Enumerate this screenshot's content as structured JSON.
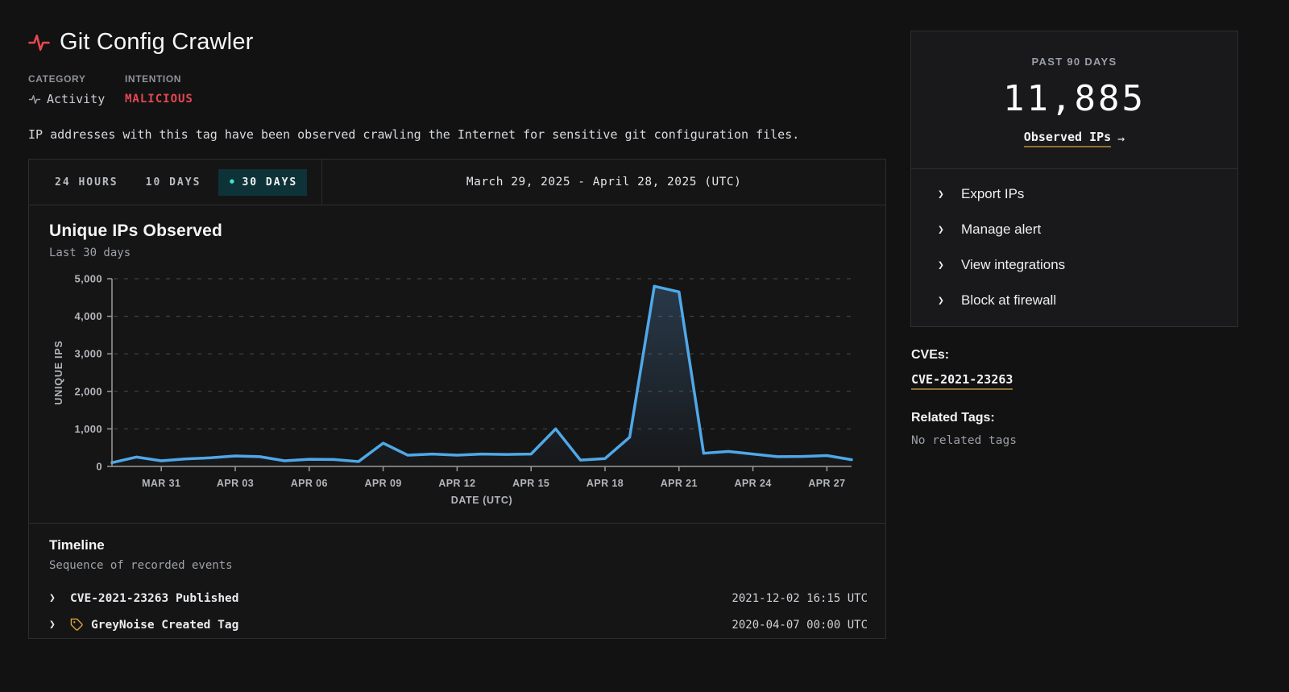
{
  "page": {
    "title": "Git Config Crawler",
    "category_label": "CATEGORY",
    "category_value": "Activity",
    "intention_label": "INTENTION",
    "intention_value": "MALICIOUS",
    "description": "IP addresses with this tag have been observed crawling the Internet for sensitive git configuration files."
  },
  "toolbar": {
    "tabs": [
      {
        "label": "24 HOURS",
        "active": false
      },
      {
        "label": "10 DAYS",
        "active": false
      },
      {
        "label": "30 DAYS",
        "active": true
      }
    ],
    "date_range": "March 29, 2025 - April 28, 2025 (UTC)"
  },
  "chart_data": {
    "type": "line",
    "title": "Unique IPs Observed",
    "subtitle": "Last 30 days",
    "xlabel": "DATE (UTC)",
    "ylabel": "UNIQUE IPS",
    "ylim": [
      0,
      5000
    ],
    "grid": "dashed-horizontal",
    "legend": "none",
    "x": [
      "MAR 29",
      "MAR 30",
      "MAR 31",
      "APR 01",
      "APR 02",
      "APR 03",
      "APR 04",
      "APR 05",
      "APR 06",
      "APR 07",
      "APR 08",
      "APR 09",
      "APR 10",
      "APR 11",
      "APR 12",
      "APR 13",
      "APR 14",
      "APR 15",
      "APR 16",
      "APR 17",
      "APR 18",
      "APR 19",
      "APR 20",
      "APR 21",
      "APR 22",
      "APR 23",
      "APR 24",
      "APR 25",
      "APR 26",
      "APR 27",
      "APR 28"
    ],
    "xtick_indices": [
      2,
      5,
      8,
      11,
      14,
      17,
      20,
      23,
      26,
      29
    ],
    "xtick_labels": [
      "MAR 31",
      "APR 03",
      "APR 06",
      "APR 09",
      "APR 12",
      "APR 15",
      "APR 18",
      "APR 21",
      "APR 24",
      "APR 27"
    ],
    "yticks": [
      0,
      1000,
      2000,
      3000,
      4000,
      5000
    ],
    "ytick_labels": [
      "0",
      "1,000",
      "2,000",
      "3,000",
      "4,000",
      "5,000"
    ],
    "series": [
      {
        "name": "Unique IPs",
        "color": "#4fa8e8",
        "values": [
          100,
          250,
          150,
          200,
          230,
          280,
          260,
          150,
          190,
          185,
          130,
          620,
          300,
          330,
          300,
          330,
          320,
          330,
          1000,
          170,
          210,
          780,
          4800,
          4650,
          350,
          400,
          330,
          260,
          265,
          290,
          180
        ]
      }
    ]
  },
  "timeline": {
    "title": "Timeline",
    "subtitle": "Sequence of recorded events",
    "events": [
      {
        "label": "CVE-2021-23263 Published",
        "timestamp": "2021-12-02 16:15 UTC"
      },
      {
        "label": "GreyNoise Created Tag",
        "timestamp": "2020-04-07 00:00 UTC"
      }
    ]
  },
  "sidebar": {
    "stat": {
      "period": "PAST 90 DAYS",
      "count": "11,885",
      "link_label": "Observed IPs"
    },
    "actions": [
      {
        "label": "Export IPs"
      },
      {
        "label": "Manage alert"
      },
      {
        "label": "View integrations"
      },
      {
        "label": "Block at firewall"
      }
    ],
    "cves_label": "CVEs:",
    "cves": [
      "CVE-2021-23263"
    ],
    "related_tags_label": "Related Tags:",
    "related_tags_empty": "No related tags"
  },
  "icons": {
    "pulse": "activity-pulse",
    "chevron_right": "❯",
    "bullet": "•",
    "arrow_right": "→",
    "tag": "tag"
  },
  "colors": {
    "accent_red": "#e5484f",
    "line_blue": "#4fa8e8",
    "tab_active_bg": "#0d3237",
    "tab_active_dot": "#3ee6cf",
    "link_underline": "#8f7233",
    "grid": "#4b4b4d",
    "axis": "#9b9b9b",
    "tick_text": "#b3b6bb"
  }
}
